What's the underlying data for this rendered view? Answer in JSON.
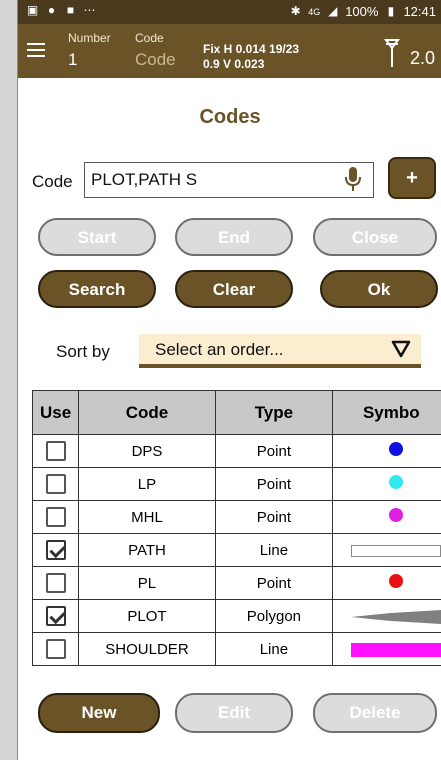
{
  "status": {
    "time": "12:41",
    "battery": "100%",
    "network": "4G"
  },
  "header": {
    "number_label": "Number",
    "number_value": "1",
    "code_label": "Code",
    "code_value": "Code",
    "fix_line1": "Fix H 0.014  19/23",
    "fix_line2": "0.9 V 0.023",
    "rod_value": "2.0"
  },
  "title": "Codes",
  "code_field": {
    "label": "Code",
    "value": "PLOT,PATH S",
    "plus_label": "+"
  },
  "buttons_row1": [
    "Start",
    "End",
    "Close"
  ],
  "buttons_row2": [
    "Search",
    "Clear",
    "Ok"
  ],
  "sort": {
    "label": "Sort by",
    "value": "Select an order..."
  },
  "table": {
    "headers": [
      "Use",
      "Code",
      "Type",
      "Symbo"
    ],
    "rows": [
      {
        "checked": false,
        "code": "DPS",
        "type": "Point",
        "symbol": "dot",
        "color": "#1010e0"
      },
      {
        "checked": false,
        "code": "LP",
        "type": "Point",
        "symbol": "dot",
        "color": "#30e8f0"
      },
      {
        "checked": false,
        "code": "MHL",
        "type": "Point",
        "symbol": "dot",
        "color": "#e020e0"
      },
      {
        "checked": true,
        "code": "PATH",
        "type": "Line",
        "symbol": "line",
        "color": "#ffffff"
      },
      {
        "checked": false,
        "code": "PL",
        "type": "Point",
        "symbol": "dot",
        "color": "#e81010"
      },
      {
        "checked": true,
        "code": "PLOT",
        "type": "Polygon",
        "symbol": "poly",
        "color": "#808080"
      },
      {
        "checked": false,
        "code": "SHOULDER",
        "type": "Line",
        "symbol": "thick",
        "color": "#ff10ff"
      }
    ]
  },
  "bottom_buttons": [
    "New",
    "Edit",
    "Delete"
  ],
  "colors": {
    "brand_dark": "#4a391d",
    "brand": "#6b5328",
    "sort_bg": "#faedd0"
  }
}
